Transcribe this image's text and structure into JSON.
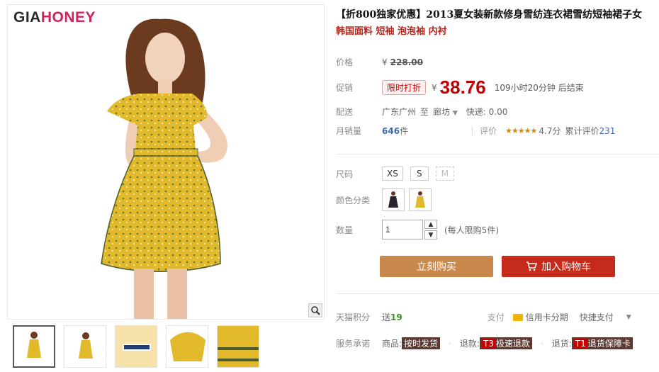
{
  "brand": {
    "logo_part1": "GIA",
    "logo_part2": "HONEY"
  },
  "product": {
    "title": "【折800独家优惠】2013夏女装新款修身雪纺连衣裙雪纺短袖裙子女",
    "subtitle": "韩国面料 短袖 泡泡袖 内衬"
  },
  "price": {
    "label": "价格",
    "currency": "¥",
    "original": "228.00",
    "promo_label": "促销",
    "promo_tag": "限时打折",
    "promo_price": "38.76",
    "countdown": "109小时20分钟 后结束"
  },
  "shipping": {
    "label": "配送",
    "from": "广东广州",
    "to_word": "至",
    "destination": "廊坊",
    "fee": "快递: 0.00"
  },
  "sales": {
    "label": "月销量",
    "count": "646",
    "unit": "件",
    "rating_label": "评价",
    "stars": "★★★★★",
    "score": "4.7分",
    "total_label": "累计评价",
    "total": "231"
  },
  "options": {
    "size_label": "尺码",
    "sizes": [
      "XS",
      "S",
      "M"
    ],
    "color_label": "颜色分类",
    "quantity_label": "数量",
    "quantity_value": "1",
    "quantity_limit": "(每人限购5件)"
  },
  "actions": {
    "buy_now": "立刻购买",
    "add_to_cart": "加入购物车"
  },
  "points": {
    "label": "天猫积分",
    "send": "送",
    "value": "19",
    "pay_label": "支付",
    "credit": "信用卡分期",
    "quick": "快捷支付"
  },
  "service": {
    "label": "服务承诺",
    "goods_label": "商品:",
    "goods_tag": "按时发货",
    "refund_label": "退款:",
    "refund_code": "T3",
    "refund_tag": "极速退款",
    "return_label": "退货:",
    "return_code": "T1",
    "return_tag": "退货保障卡"
  },
  "colors": {
    "dress_yellow": "#e2b92a",
    "price_red": "#c40000",
    "buy_button": "#c9884c",
    "cart_button": "#c62a1a"
  }
}
